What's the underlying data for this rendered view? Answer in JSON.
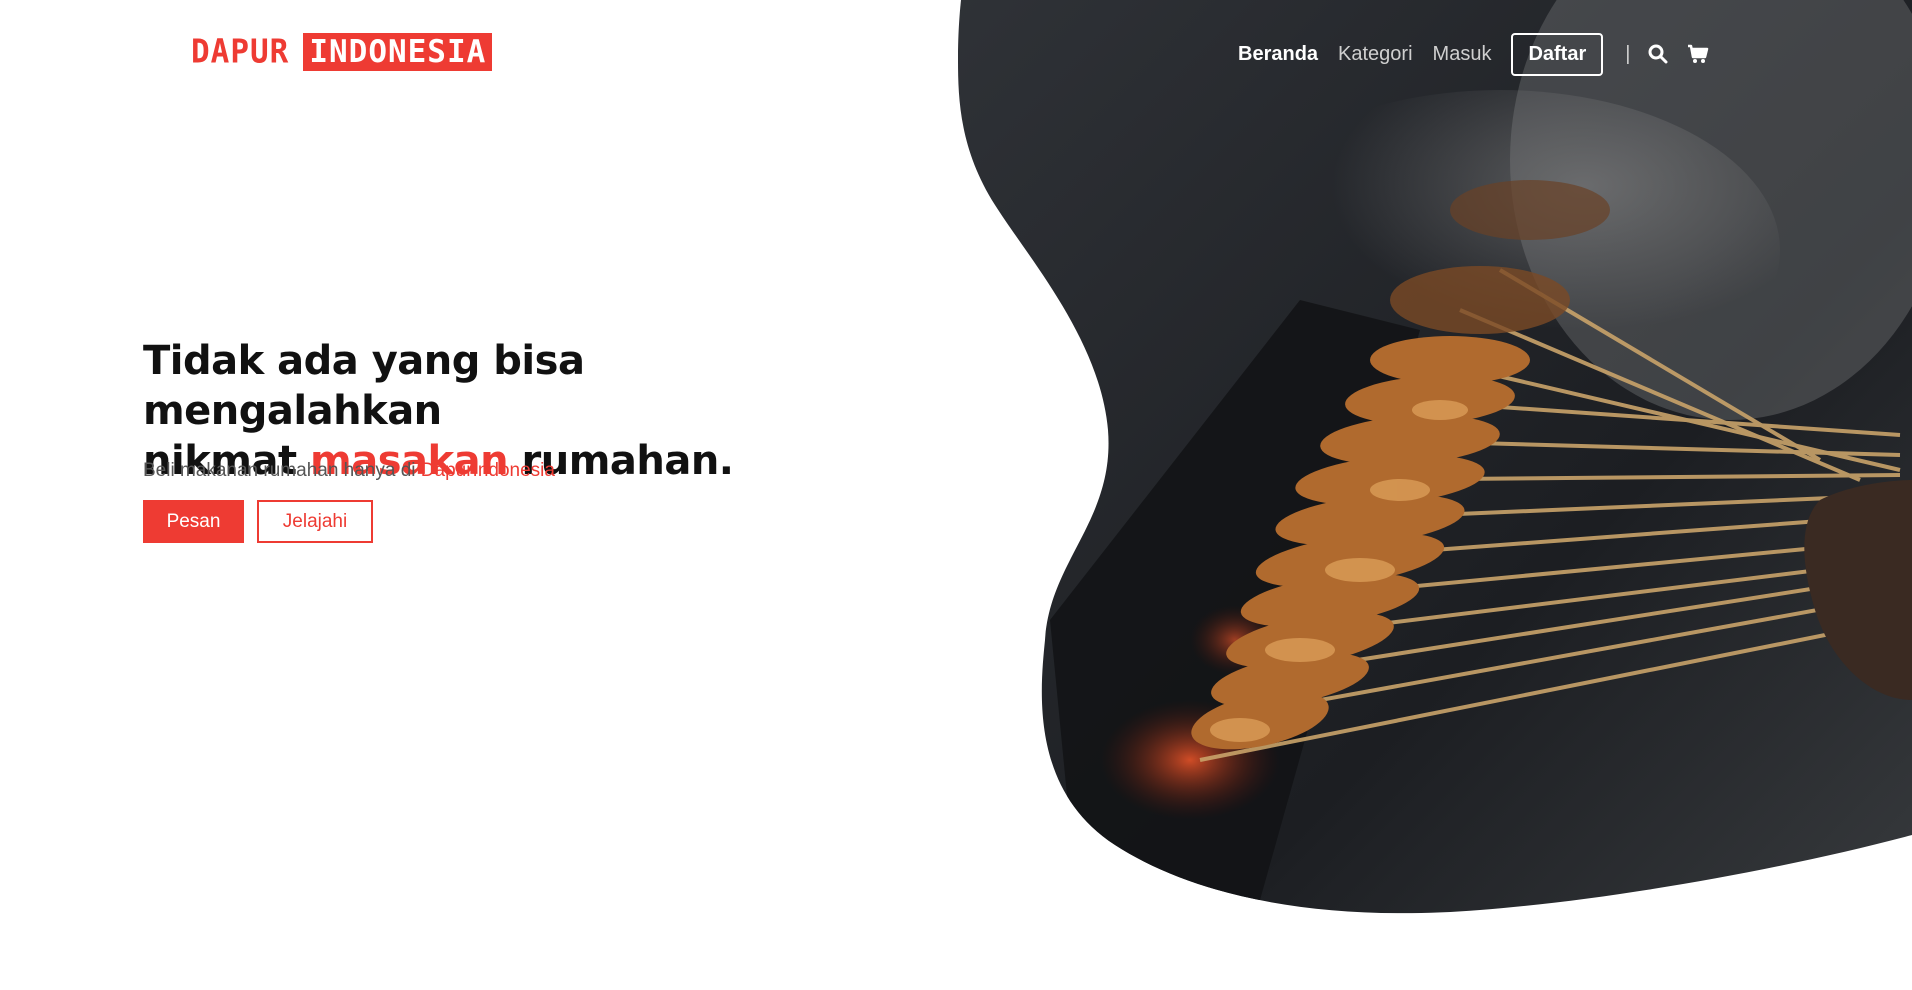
{
  "brand": {
    "word1": "DAPUR",
    "word2": "INDONESIA",
    "color": "#ee3b33"
  },
  "nav": {
    "items": [
      {
        "label": "Beranda",
        "active": true
      },
      {
        "label": "Kategori",
        "active": false
      },
      {
        "label": "Masuk",
        "active": false
      }
    ],
    "signup_label": "Daftar",
    "separator": "|",
    "icons": [
      "search-icon",
      "cart-icon"
    ]
  },
  "hero": {
    "headline_part1": "Tidak ada yang bisa mengalahkan",
    "headline_part2": "nikmat ",
    "headline_accent": "masakan",
    "headline_part3": " rumahan.",
    "sub_text": "Beli makanan rumahan hanya di ",
    "sub_brand": "DapurIndonesia",
    "primary_button": "Pesan",
    "secondary_button": "Jelajahi",
    "image_subject": "satay-skewers-grilling"
  }
}
